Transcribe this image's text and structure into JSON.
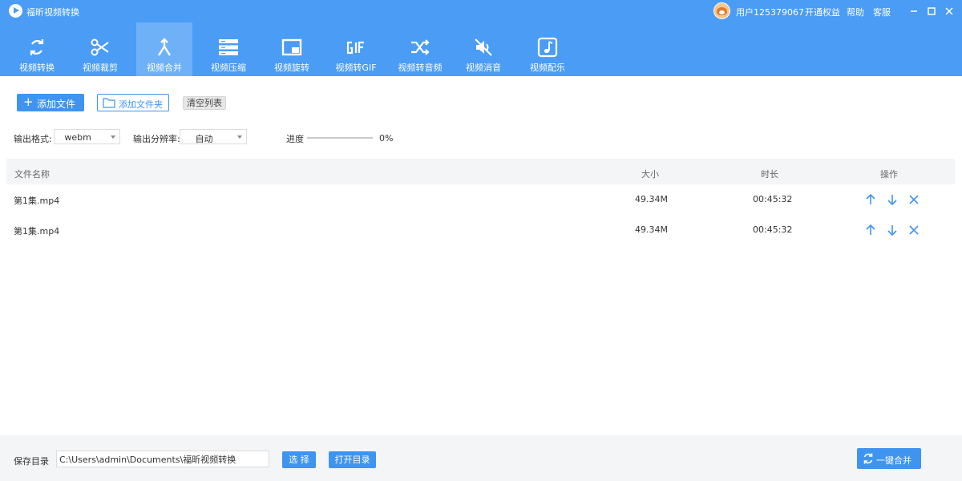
{
  "app": {
    "title": "福昕视频转换",
    "logo_icon": "play-logo-icon"
  },
  "topbar": {
    "user": "用户125379067",
    "upgrade": "开通权益",
    "help": "帮助",
    "service": "客服"
  },
  "toolbar": {
    "active_index": 2,
    "tools": [
      {
        "label": "视频转换",
        "icon": "convert-refresh-icon"
      },
      {
        "label": "视频裁剪",
        "icon": "scissors-icon"
      },
      {
        "label": "视频合并",
        "icon": "merge-arrows-icon"
      },
      {
        "label": "视频压缩",
        "icon": "compress-icon"
      },
      {
        "label": "视频旋转",
        "icon": "rotate-screen-icon"
      },
      {
        "label": "视频转GIF",
        "icon": "gif-icon"
      },
      {
        "label": "视频转音频",
        "icon": "shuffle-icon"
      },
      {
        "label": "视频消音",
        "icon": "mute-speaker-icon"
      },
      {
        "label": "视频配乐",
        "icon": "music-note-icon"
      }
    ]
  },
  "actions": {
    "add_file": "添加文件",
    "add_folder": "添加文件夹",
    "clear_list": "清空列表"
  },
  "settings": {
    "format_label": "输出格式:",
    "format_value": "webm",
    "resolution_label": "输出分辨率:",
    "resolution_value": "自动",
    "progress_label": "进度",
    "progress_text": "0%",
    "progress_fraction": 0
  },
  "table": {
    "headers": {
      "name": "文件名称",
      "size": "大小",
      "duration": "时长",
      "ops": "操作"
    },
    "rows": [
      {
        "name": "第1集.mp4",
        "size": "49.34M",
        "duration": "00:45:32"
      },
      {
        "name": "第1集.mp4",
        "size": "49.34M",
        "duration": "00:45:32"
      }
    ]
  },
  "footer": {
    "save_label": "保存目录",
    "save_path": "C:\\Users\\admin\\Documents\\福昕视频转换",
    "choose": "选 择",
    "open_dir": "打开目录",
    "merge": "一键合并"
  },
  "colors": {
    "primary": "#4a9cf5",
    "button": "#3f94f0",
    "active_tab": "#6fb1f7"
  }
}
